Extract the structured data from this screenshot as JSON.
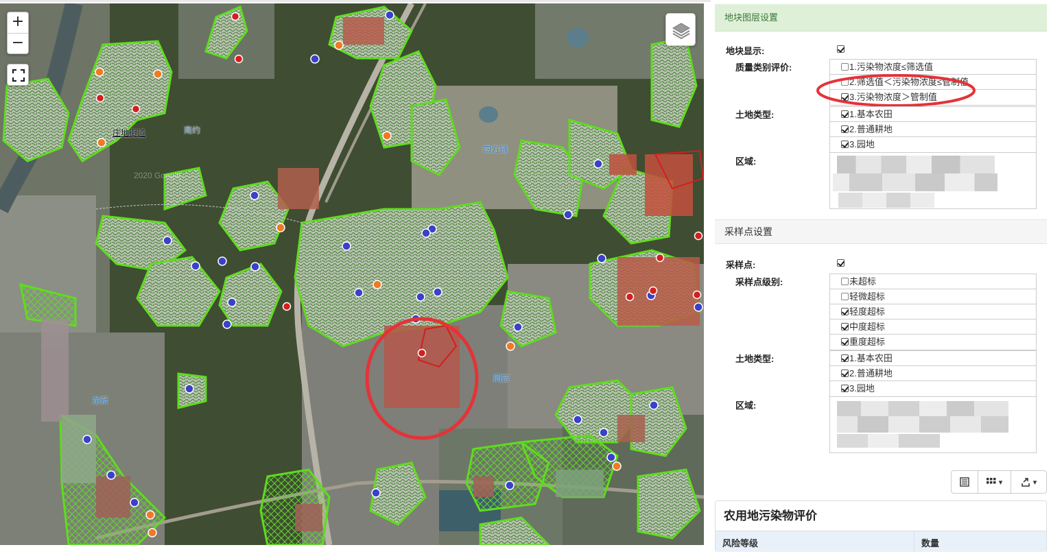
{
  "map": {
    "zoom_in": "+",
    "zoom_out": "−",
    "labels": {
      "street": "庄地街道",
      "east": "四方铺",
      "lower_left": "龙新",
      "center_south": "同富",
      "watermark_1": "2020 Google",
      "faint_1": "南约"
    }
  },
  "panel": {
    "parcel_section": {
      "title": "地块图层设置",
      "display_label": "地块显示:",
      "display_checked": true,
      "quality_label": "质量类别评价:",
      "quality_options": [
        {
          "label": "1.污染物浓度≤筛选值",
          "checked": false
        },
        {
          "label": "2.筛选值＜污染物浓度≤管制值",
          "checked": false
        },
        {
          "label": "3.污染物浓度＞管制值",
          "checked": true
        }
      ],
      "land_label": "土地类型:",
      "land_options": [
        {
          "label": "1.基本农田",
          "checked": true
        },
        {
          "label": "2.普通耕地",
          "checked": true
        },
        {
          "label": "3.园地",
          "checked": true
        }
      ],
      "region_label": "区域:"
    },
    "sample_section": {
      "title": "采样点设置",
      "display_label": "采样点:",
      "display_checked": true,
      "level_label": "采样点级别:",
      "level_options": [
        {
          "label": "未超标",
          "checked": false
        },
        {
          "label": "轻微超标",
          "checked": false
        },
        {
          "label": "轻度超标",
          "checked": true
        },
        {
          "label": "中度超标",
          "checked": true
        },
        {
          "label": "重度超标",
          "checked": true
        }
      ],
      "land_label": "土地类型:",
      "land_options": [
        {
          "label": "1.基本农田",
          "checked": true
        },
        {
          "label": "2.普通耕地",
          "checked": true
        },
        {
          "label": "3.园地",
          "checked": true
        }
      ],
      "region_label": "区域:"
    },
    "toolbar": {
      "list_icon": "list-icon",
      "columns_icon": "grid-columns-icon",
      "export_icon": "export-icon"
    },
    "evaluation": {
      "title": "农用地污染物评价",
      "col_risk": "风险等级",
      "col_count": "数量"
    }
  },
  "colors": {
    "parcel_fill": "#b5bfae",
    "parcel_border": "#5fdc1e",
    "highlight_red": "#e53238",
    "header_green_bg": "#dff0d8",
    "header_green_text": "#3c763d",
    "point_blue": "#3a42c8",
    "point_red": "#d21f1f",
    "point_orange": "#ef7a24"
  }
}
